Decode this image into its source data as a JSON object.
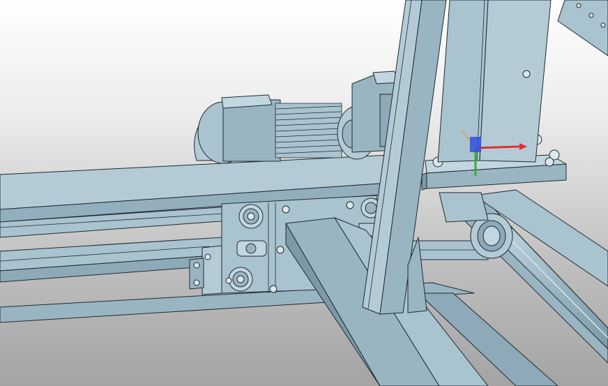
{
  "viewport": {
    "background_top": "#ffffff",
    "background_bottom": "#a4a4a4"
  },
  "model": {
    "fill": "#a9c3cf",
    "fill_light": "#c2d6df",
    "fill_dark": "#8eaab8",
    "edge": "#1f2a30"
  },
  "triad": {
    "x_color": "#e03030",
    "y_color": "#30b030",
    "z_color": "#3050e0"
  }
}
